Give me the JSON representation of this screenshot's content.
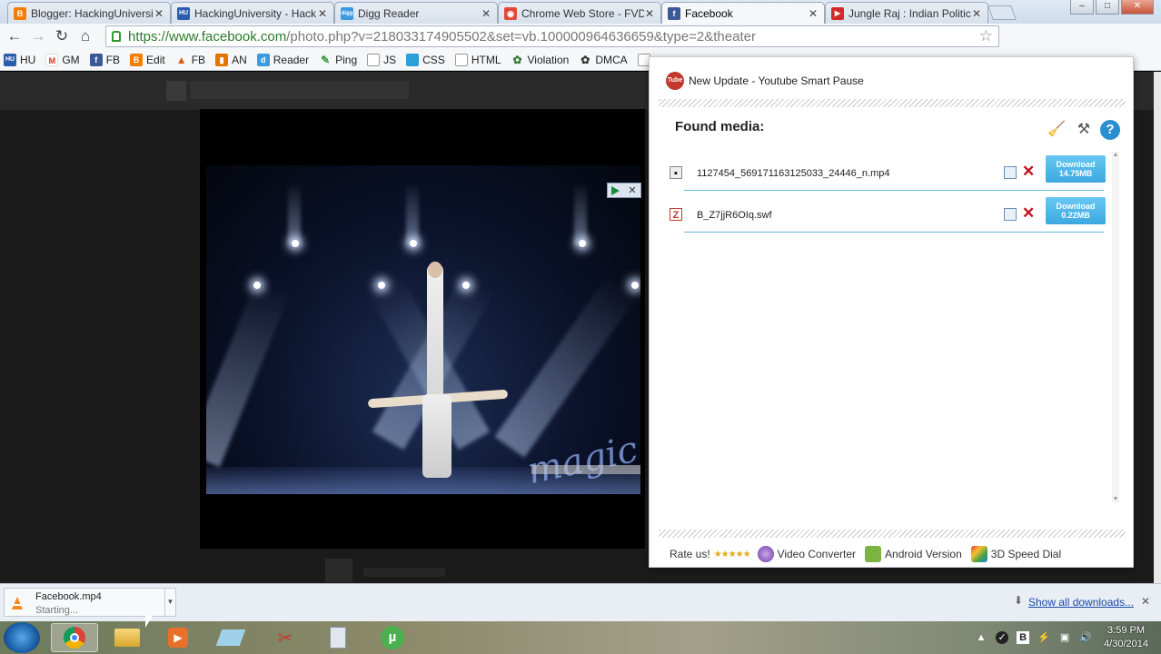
{
  "tabs": [
    {
      "title": "Blogger: HackingUniversit",
      "icon_color": "#f57d00",
      "icon_glyph": "B"
    },
    {
      "title": "HackingUniversity - Hack",
      "icon_color": "#2a5db0",
      "icon_glyph": "HU"
    },
    {
      "title": "Digg Reader",
      "icon_color": "#3b9be0",
      "icon_glyph": "digg"
    },
    {
      "title": "Chrome Web Store - FVD",
      "icon_color": "#e04a3a",
      "icon_glyph": "◉"
    },
    {
      "title": "Facebook",
      "icon_color": "#3b5998",
      "icon_glyph": "f"
    },
    {
      "title": "Jungle Raj : Indian Politic",
      "icon_color": "#d62a2a",
      "icon_glyph": "▶"
    }
  ],
  "active_tab_index": 4,
  "url": {
    "scheme_host": "https://www.facebook.com",
    "path": "/photo.php?v=218033174905502&set=vb.100000964636659&type=2&theater"
  },
  "bookmarks": [
    {
      "label": "HU",
      "icon": "hu-icon",
      "color": "#2a5db0",
      "glyph": "HU"
    },
    {
      "label": "GM",
      "icon": "gmail-icon",
      "color": "#d93025",
      "glyph": "M"
    },
    {
      "label": "FB",
      "icon": "facebook-icon",
      "color": "#3b5998",
      "glyph": "f"
    },
    {
      "label": "Edit",
      "icon": "blogger-icon",
      "color": "#f57d00",
      "glyph": "B"
    },
    {
      "label": "FB",
      "icon": "flame-icon",
      "color": "#e05a1a",
      "glyph": "▲"
    },
    {
      "label": "AN",
      "icon": "analytics-icon",
      "color": "#e37400",
      "glyph": "▮"
    },
    {
      "label": "Reader",
      "icon": "digg-icon",
      "color": "#3b9be0",
      "glyph": "d"
    },
    {
      "label": "Ping",
      "icon": "ping-icon",
      "color": "#3aa03a",
      "glyph": "✎"
    },
    {
      "label": "JS",
      "icon": "page-icon",
      "color": "#bbbbbb",
      "glyph": ""
    },
    {
      "label": "CSS",
      "icon": "css-icon",
      "color": "#2b9fd8",
      "glyph": ""
    },
    {
      "label": "HTML",
      "icon": "page-icon",
      "color": "#bbbbbb",
      "glyph": ""
    },
    {
      "label": "Violation",
      "icon": "violation-icon",
      "color": "#2e7d32",
      "glyph": "✿"
    },
    {
      "label": "DMCA",
      "icon": "dmca-icon",
      "color": "#333333",
      "glyph": "✿"
    }
  ],
  "popup": {
    "update_text": "New Update - Youtube Smart Pause",
    "found_title": "Found media:",
    "media": [
      {
        "name": "1127454_569171163125033_24446_n.mp4",
        "type": "mp4",
        "download_label": "Download",
        "size": "14.75MB"
      },
      {
        "name": "B_Z7jjR6OIq.swf",
        "type": "swf",
        "download_label": "Download",
        "size": "0.22MB"
      }
    ],
    "footer": {
      "rate": "Rate us!",
      "stars": "★★★★★",
      "video_converter": "Video Converter",
      "android": "Android Version",
      "speed_dial": "3D Speed Dial"
    }
  },
  "video_overlay_text": "magic",
  "download_bar": {
    "filename": "Facebook.mp4",
    "status": "Starting...",
    "show_all": "Show all downloads..."
  },
  "taskbar": {
    "time": "3:59 PM",
    "date": "4/30/2014"
  },
  "colors": {
    "facebook_blue": "#3b5998",
    "download_button": "#3aa8e0",
    "delete_red": "#c0121c"
  }
}
